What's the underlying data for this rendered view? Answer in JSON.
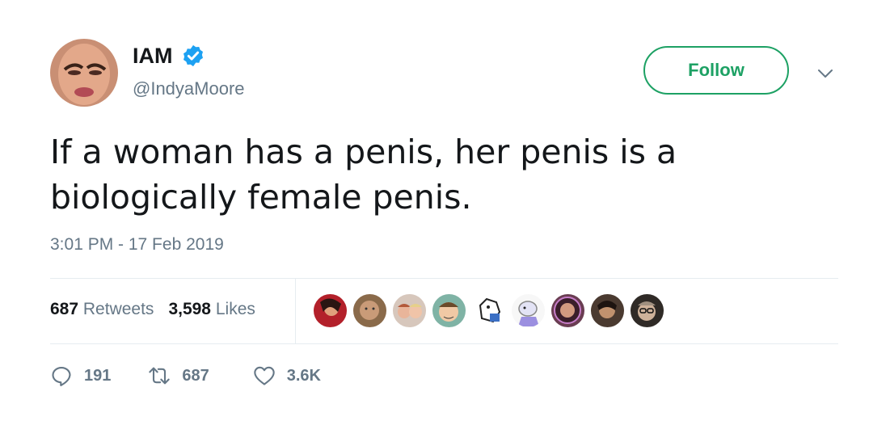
{
  "tweet": {
    "author": {
      "display_name": "IAM",
      "handle": "@IndyaMoore",
      "avatar_icon": "user-avatar",
      "verified_icon": "verified-badge-icon"
    },
    "follow_label": "Follow",
    "text": "If a woman has a penis, her penis is a biologically female penis.",
    "timestamp": "3:01 PM - 17 Feb 2019",
    "stats": {
      "retweets_count": "687",
      "retweets_label": "Retweets",
      "likes_count": "3,598",
      "likes_label": "Likes"
    },
    "liker_avatar_count": 9,
    "actions": {
      "reply_count": "191",
      "retweet_count": "687",
      "like_count": "3.6K"
    }
  },
  "colors": {
    "accent_green": "#1da164",
    "verified_blue": "#1da1f2",
    "text_primary": "#14171a",
    "text_secondary": "#657786",
    "divider": "#e6ecf0"
  }
}
